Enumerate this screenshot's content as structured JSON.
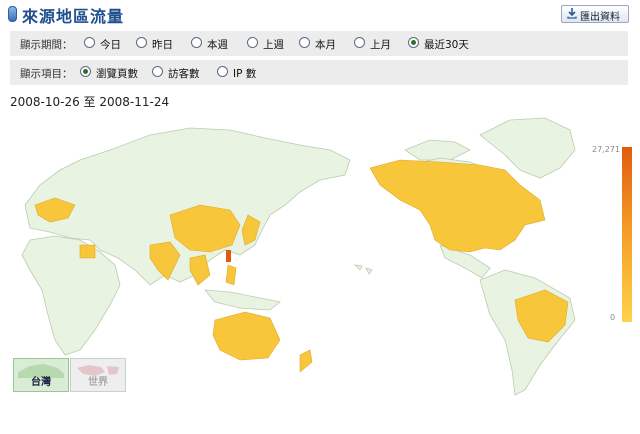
{
  "header": {
    "title": "來源地區流量",
    "export_label": "匯出資料"
  },
  "period": {
    "label": "顯示期間：",
    "options": [
      "今日",
      "昨日",
      "本週",
      "上週",
      "本月",
      "上月",
      "最近30天"
    ],
    "selected": "最近30天"
  },
  "metric": {
    "label": "顯示項目：",
    "options": [
      "瀏覽頁數",
      "訪客數",
      "IP 數"
    ],
    "selected": "瀏覽頁數"
  },
  "date_range": "2008-10-26 至 2008-11-24",
  "legend": {
    "max": "27,271",
    "min": "0",
    "high_color": "#e25a10",
    "low_color": "#ffd24a"
  },
  "map": {
    "land_color": "#e8f3e2",
    "border_color": "#b9cdb0",
    "highlight_color": "#f8c63a",
    "accent_color": "#f39a26"
  },
  "zoom_buttons": [
    {
      "label": "台灣",
      "active": true
    },
    {
      "label": "世界",
      "active": false
    }
  ]
}
